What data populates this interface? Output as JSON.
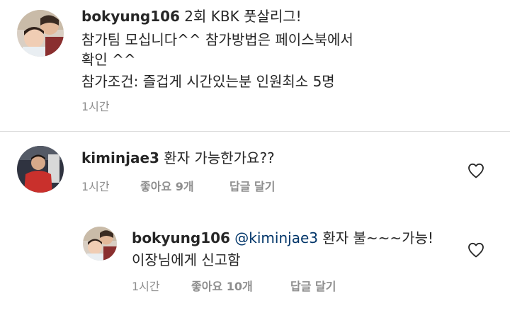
{
  "caption": {
    "username": "bokyung106",
    "lines": [
      "2회 KBK 풋살리그!",
      "참가팀 모십니다^^ 참가방법은 페이스북에서",
      "확인 ^^",
      "참가조건: 즐겁게 시간있는분 인원최소 5명"
    ],
    "time": "1시간"
  },
  "comments": [
    {
      "username": "kiminjae3",
      "text": "환자 가능한가요??",
      "time": "1시간",
      "likes": "좋아요 9개",
      "reply_label": "답글 달기",
      "like_icon": "heart-outline-icon"
    }
  ],
  "replies": [
    {
      "username": "bokyung106",
      "mention": "@kiminjae3",
      "text_after_mention": "환자 불~~~가능!",
      "text_line2": "이장님에게 신고함",
      "time": "1시간",
      "likes": "좋아요 10개",
      "reply_label": "답글 달기",
      "like_icon": "heart-outline-icon"
    }
  ],
  "colors": {
    "text": "#262626",
    "meta": "#8e8e8e",
    "mention": "#003569",
    "divider": "#dbdbdb"
  }
}
